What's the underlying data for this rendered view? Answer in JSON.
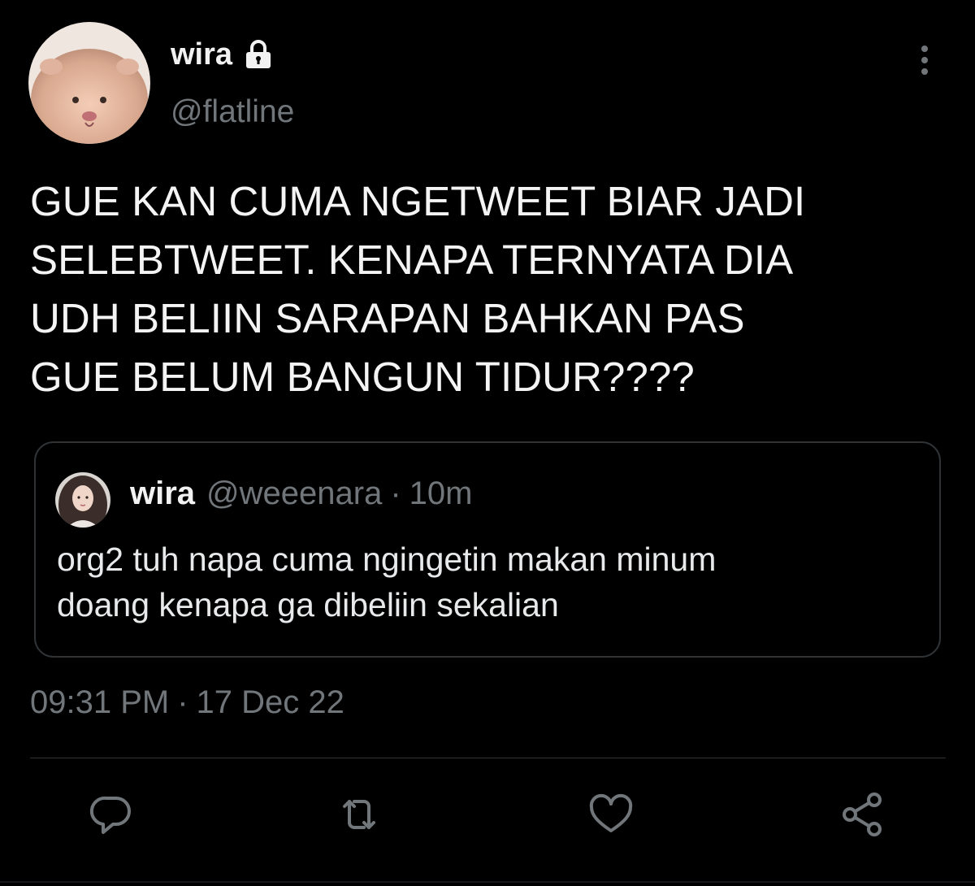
{
  "author": {
    "display_name": "wira",
    "handle": "@flatline",
    "avatar_icon": "hamster-avatar",
    "protected_icon": "lock-icon"
  },
  "tweet": {
    "text": "GUE KAN CUMA NGETWEET BIAR JADI\nSELEBTWEET. KENAPA TERNYATA DIA\nUDH BELIIN SARAPAN BAHKAN PAS\nGUE BELUM BANGUN TIDUR????"
  },
  "quoted_tweet": {
    "display_name": "wira",
    "handle": "@weeenara",
    "separator": "·",
    "time": "10m",
    "text": "org2 tuh napa cuma ngingetin makan minum\ndoang kenapa ga dibeliin sekalian"
  },
  "timestamp": {
    "time": "09:31 PM",
    "separator": "·",
    "date": "17 Dec 22"
  },
  "actions": {
    "reply_icon": "reply-icon",
    "retweet_icon": "retweet-icon",
    "like_icon": "heart-icon",
    "share_icon": "share-icon",
    "more_icon": "more-vertical-icon"
  },
  "colors": {
    "background": "#000000",
    "primary_text": "#e7e9ea",
    "secondary_text": "#71767b",
    "border": "#2f3336"
  }
}
